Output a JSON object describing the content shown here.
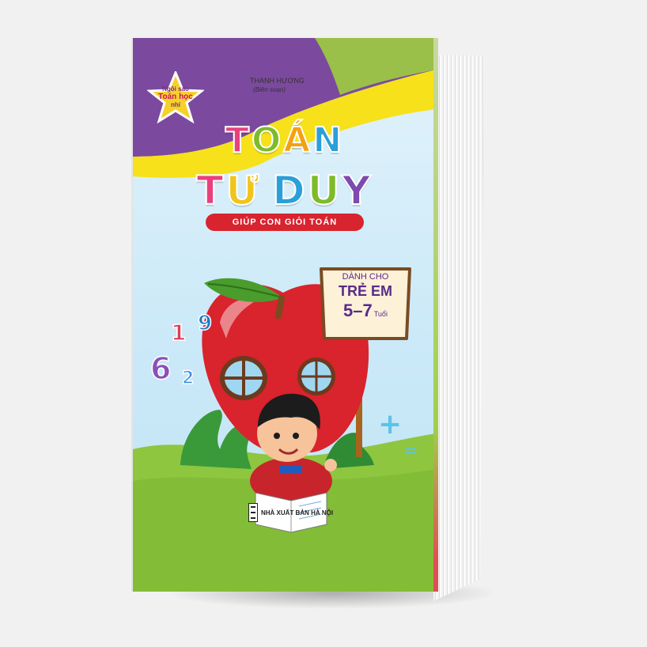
{
  "cover": {
    "series_badge": {
      "line1": "Ngôi sao",
      "line2": "Toán học",
      "line3": "nhí"
    },
    "author": {
      "name": "THANH HƯƠNG",
      "role": "(Biên soạn)"
    },
    "title_line1": [
      "T",
      "O",
      "Á",
      "N"
    ],
    "title_line2": [
      "T",
      "Ư",
      " ",
      "D",
      "U",
      "Y"
    ],
    "subtitle": "GIÚP CON GIỎI TOÁN",
    "sign": {
      "line1": "DÀNH CHO",
      "line2": "TRẺ EM",
      "age": "5–7",
      "unit": "Tuổi"
    },
    "floating_digits": [
      "6",
      "1",
      "9",
      "2"
    ],
    "symbols": {
      "plus": "+",
      "equals": "="
    },
    "publisher": "NHÀ XUẤT BẢN HÀ NỘI"
  },
  "colors": {
    "purple_band": "#7b4a9e",
    "yellow_band": "#f6e11a",
    "green_band": "#9fcd3f",
    "apple_red": "#d9232d",
    "grass": "#8ec63f",
    "title_colors": [
      "#e8417e",
      "#7dbb2a",
      "#f4a011",
      "#2b9fd8",
      "#e8417e",
      "#f0c419",
      "#7d4ab0",
      "#2b9fd8"
    ]
  }
}
